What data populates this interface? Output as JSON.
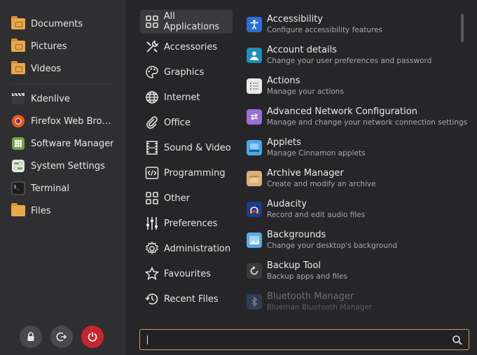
{
  "sidebar": {
    "places": [
      {
        "label": "Documents",
        "icon": "folder-documents-icon"
      },
      {
        "label": "Pictures",
        "icon": "folder-pictures-icon"
      },
      {
        "label": "Videos",
        "icon": "folder-videos-icon"
      }
    ],
    "favorites": [
      {
        "label": "Kdenlive",
        "icon": "kdenlive-icon"
      },
      {
        "label": "Firefox Web Bro…",
        "icon": "firefox-icon"
      },
      {
        "label": "Software Manager",
        "icon": "software-manager-icon"
      },
      {
        "label": "System Settings",
        "icon": "system-settings-icon"
      },
      {
        "label": "Terminal",
        "icon": "terminal-icon"
      },
      {
        "label": "Files",
        "icon": "files-icon"
      }
    ],
    "session_buttons": [
      {
        "name": "lock-screen",
        "icon": "lock-icon"
      },
      {
        "name": "logout",
        "icon": "logout-icon"
      },
      {
        "name": "shutdown",
        "icon": "power-icon"
      }
    ]
  },
  "categories": [
    {
      "label": "All Applications",
      "icon": "grid-icon",
      "active": true
    },
    {
      "label": "Accessories",
      "icon": "tools-icon"
    },
    {
      "label": "Graphics",
      "icon": "palette-icon"
    },
    {
      "label": "Internet",
      "icon": "globe-icon"
    },
    {
      "label": "Office",
      "icon": "paperclip-icon"
    },
    {
      "label": "Sound & Video",
      "icon": "film-icon"
    },
    {
      "label": "Programming",
      "icon": "code-icon"
    },
    {
      "label": "Other",
      "icon": "grid-icon"
    },
    {
      "label": "Preferences",
      "icon": "sliders-icon"
    },
    {
      "label": "Administration",
      "icon": "gear-icon"
    },
    {
      "label": "Favourites",
      "icon": "star-icon"
    },
    {
      "label": "Recent Files",
      "icon": "history-icon"
    }
  ],
  "apps": [
    {
      "name": "Accessibility",
      "desc": "Configure accessibility features",
      "icon": "accessibility-icon",
      "color": "#2a6fd6"
    },
    {
      "name": "Account details",
      "desc": "Change your user preferences and password",
      "icon": "account-icon",
      "color": "#1e8fb8"
    },
    {
      "name": "Actions",
      "desc": "Manage your actions",
      "icon": "actions-icon",
      "color": "#e9e9e9"
    },
    {
      "name": "Advanced Network Configuration",
      "desc": "Manage and change your network connection settings",
      "icon": "network-icon",
      "color": "#9b6fd6"
    },
    {
      "name": "Applets",
      "desc": "Manage Cinnamon applets",
      "icon": "applets-icon",
      "color": "#4aa8e6"
    },
    {
      "name": "Archive Manager",
      "desc": "Create and modify an archive",
      "icon": "archive-icon",
      "color": "#d9b27a"
    },
    {
      "name": "Audacity",
      "desc": "Record and edit audio files",
      "icon": "audacity-icon",
      "color": "#1f3a8a"
    },
    {
      "name": "Backgrounds",
      "desc": "Change your desktop's background",
      "icon": "backgrounds-icon",
      "color": "#5aa9e6"
    },
    {
      "name": "Backup Tool",
      "desc": "Backup apps and files",
      "icon": "backup-icon",
      "color": "#3a3a3a"
    },
    {
      "name": "Bluetooth Manager",
      "desc": "Blueman Bluetooth Manager",
      "icon": "bluetooth-icon",
      "color": "#3b5d9c",
      "faded": true
    }
  ],
  "search": {
    "value": "",
    "icon": "search-icon"
  },
  "colors": {
    "accent": "#c8a064",
    "power": "#c9242b",
    "folder": "#e8a84a"
  }
}
